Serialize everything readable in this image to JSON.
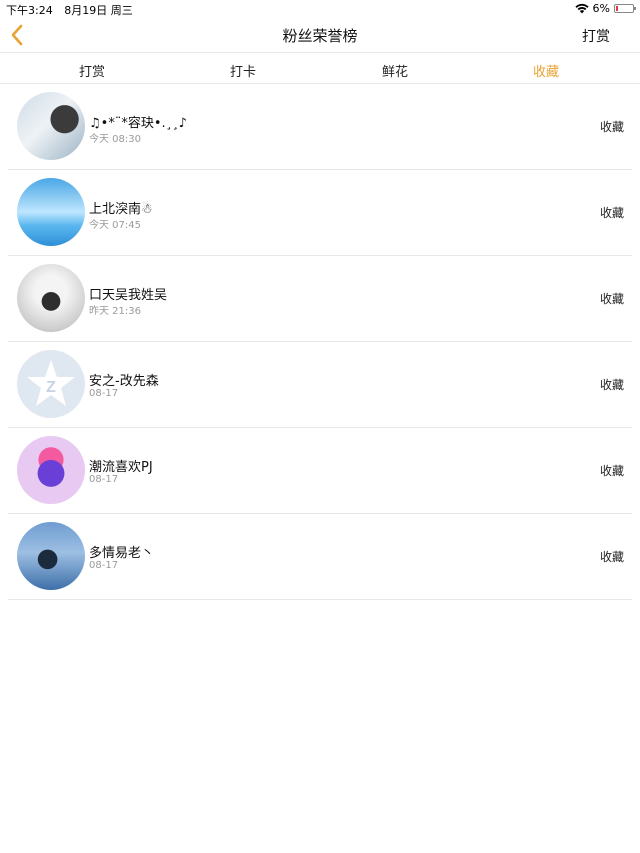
{
  "status_bar": {
    "time": "下午3:24",
    "date": "8月19日 周三",
    "battery": "6%"
  },
  "nav": {
    "title": "粉丝荣誉榜",
    "action": "打赏"
  },
  "tabs": [
    {
      "label": "打赏",
      "active": false
    },
    {
      "label": "打卡",
      "active": false
    },
    {
      "label": "鲜花",
      "active": false
    },
    {
      "label": "收藏",
      "active": true
    }
  ],
  "colors": {
    "accent": "#e8a330",
    "battery_low": "#e53935"
  },
  "rows": [
    {
      "name": "♫•*¨*容玦•.¸¸♪",
      "time": "今天 08:30",
      "action": "收藏"
    },
    {
      "name": "上北湥南☃",
      "time": "今天 07:45",
      "action": "收藏"
    },
    {
      "name": "口天吴我姓吴",
      "time": "昨天 21:36",
      "action": "收藏"
    },
    {
      "name": "安之-改先森",
      "time": "08-17",
      "action": "收藏"
    },
    {
      "name": "潮流喜欢PJ",
      "time": "08-17",
      "action": "收藏"
    },
    {
      "name": "多情易老丶",
      "time": "08-17",
      "action": "收藏"
    }
  ]
}
